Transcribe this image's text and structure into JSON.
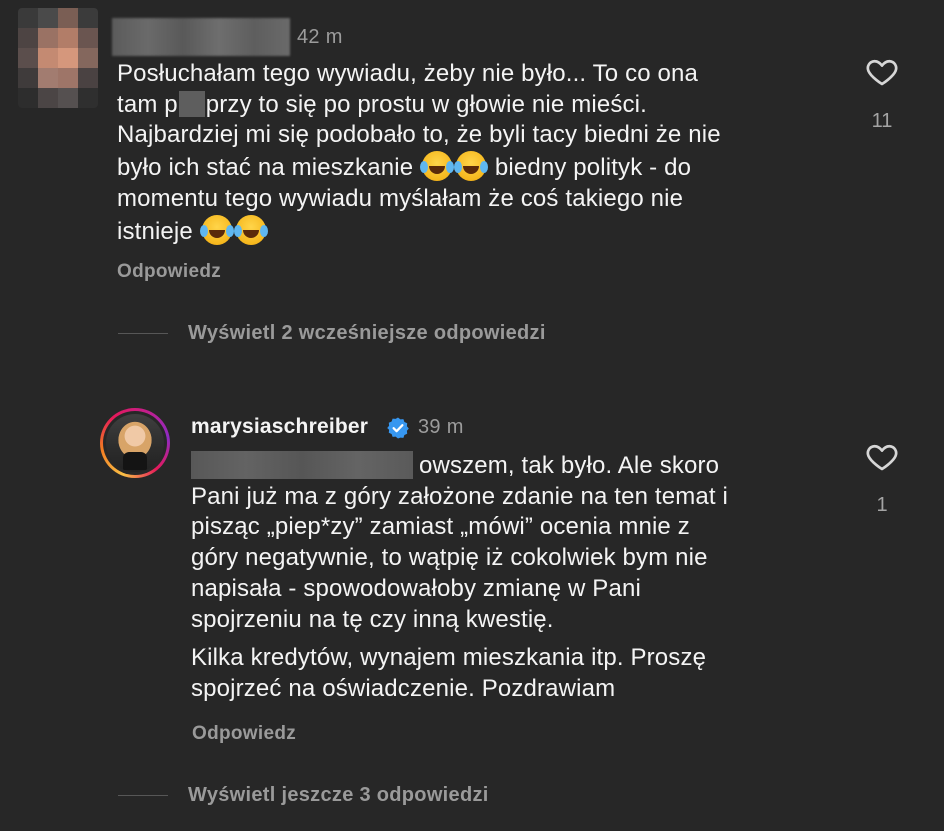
{
  "comment": {
    "time": "42 m",
    "text_lines": [
      [
        "Posłuchałam tego wywiadu, żeby nie było... To co ona"
      ],
      [
        "tam p",
        "[censor]",
        "przy to się po prostu w głowie nie mieści."
      ],
      [
        "Najbardziej mi się podobało to, że byli tacy biedni że nie"
      ],
      [
        "było ich stać na mieszkanie ",
        "[emoji]",
        "[emoji]",
        " biedny polityk - do"
      ],
      [
        "momentu tego wywiadu myślałam że coś takiego nie"
      ],
      [
        "istnieje ",
        "[emoji]",
        "[emoji]"
      ]
    ],
    "line1": "Posłuchałam tego wywiadu, żeby nie było... To co ona",
    "line2a": "tam p",
    "line2b": "przy to się po prostu w głowie nie mieści.",
    "line3": "Najbardziej mi się podobało to, że byli tacy biedni że nie",
    "line4a": "było ich stać na mieszkanie",
    "line4b": "biedny polityk - do",
    "line5": "momentu tego wywiadu myślałam że coś takiego nie",
    "line6": "istnieje",
    "reply_label": "Odpowiedz",
    "like_count": "11",
    "emoji_name": "face-with-tears-of-joy-icon"
  },
  "thread_toggle_1": {
    "label": "Wyświetl 2 wcześniejsze odpowiedzi"
  },
  "reply": {
    "username": "marysiaschreiber",
    "time": "39 m",
    "line1": "owszem, tak było. Ale skoro",
    "line2": "Pani już ma z góry założone zdanie na ten temat i",
    "line3": "pisząc „piep*zy” zamiast „mówi” ocenia mnie z",
    "line4": "góry negatywnie, to wątpię iż cokolwiek bym nie",
    "line5": "napisała - spowodowałoby zmianę w Pani",
    "line6": "spojrzeniu na tę czy inną kwestię.",
    "line7": "Kilka kredytów, wynajem mieszkania itp. Proszę",
    "line8": "spojrzeć na oświadczenie. Pozdrawiam",
    "reply_label": "Odpowiedz",
    "like_count": "1"
  },
  "thread_toggle_2": {
    "label": "Wyświetl jeszcze 3 odpowiedzi"
  },
  "colors": {
    "background": "#272727",
    "text": "#f4f4f4",
    "muted": "#9a9a9a",
    "verified": "#3797f0"
  }
}
